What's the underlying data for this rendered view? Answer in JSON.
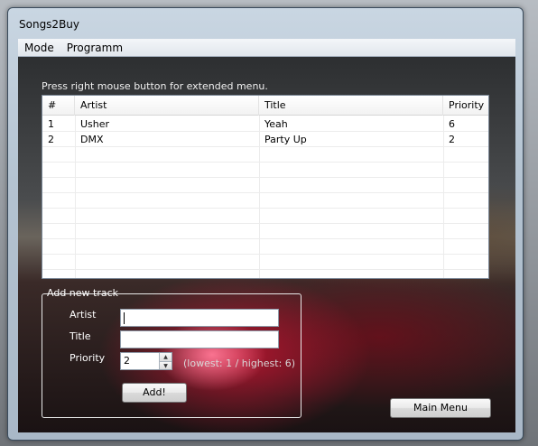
{
  "window": {
    "title": "Songs2Buy"
  },
  "menu": {
    "items": [
      "Mode",
      "Programm"
    ]
  },
  "hint": "Press right mouse button for extended menu.",
  "table": {
    "columns": [
      "#",
      "Artist",
      "Title",
      "Priority"
    ],
    "rows": [
      [
        "1",
        "Usher",
        "Yeah",
        "6"
      ],
      [
        "2",
        "DMX",
        "Party Up",
        "2"
      ]
    ]
  },
  "add_track": {
    "group_title": "Add new track",
    "artist_label": "Artist",
    "artist_value": "",
    "title_label": "Title",
    "title_value": "",
    "priority_label": "Priority",
    "priority_value": "2",
    "priority_range_note": "(lowest: 1 / highest: 6)",
    "add_button": "Add!"
  },
  "main_menu_button": "Main Menu",
  "icons": {
    "spin_up": "spin-up-icon",
    "spin_down": "spin-down-icon"
  },
  "colors": {
    "accent": "#c81e3c"
  }
}
